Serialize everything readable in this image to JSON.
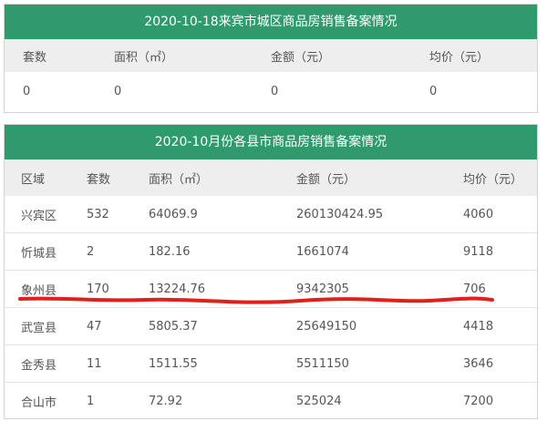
{
  "city": {
    "title": "2020-10-18来宾市城区商品房销售备案情况",
    "headers": [
      "套数",
      "面积（㎡）",
      "金额（元）",
      "均价（元）"
    ],
    "values": [
      "0",
      "0",
      "0",
      "0"
    ]
  },
  "county": {
    "title": "2020-10月份各县市商品房销售备案情况",
    "headers": [
      "区域",
      "套数",
      "面积（㎡）",
      "金额（元）",
      "均价（元）"
    ],
    "rows": [
      [
        "兴宾区",
        "532",
        "64069.9",
        "260130424.95",
        "4060"
      ],
      [
        "忻城县",
        "2",
        "182.16",
        "1661074",
        "9118"
      ],
      [
        "象州县",
        "170",
        "13224.76",
        "9342305",
        "706"
      ],
      [
        "武宣县",
        "47",
        "5805.37",
        "25649150",
        "4418"
      ],
      [
        "金秀县",
        "11",
        "1511.55",
        "5511150",
        "3646"
      ],
      [
        "合山市",
        "1",
        "72.92",
        "525024",
        "7200"
      ]
    ]
  },
  "colors": {
    "header_bar": "#2f9b6d",
    "column_header_bg": "#eeeeee",
    "annotation_underline": "#e0201a"
  }
}
